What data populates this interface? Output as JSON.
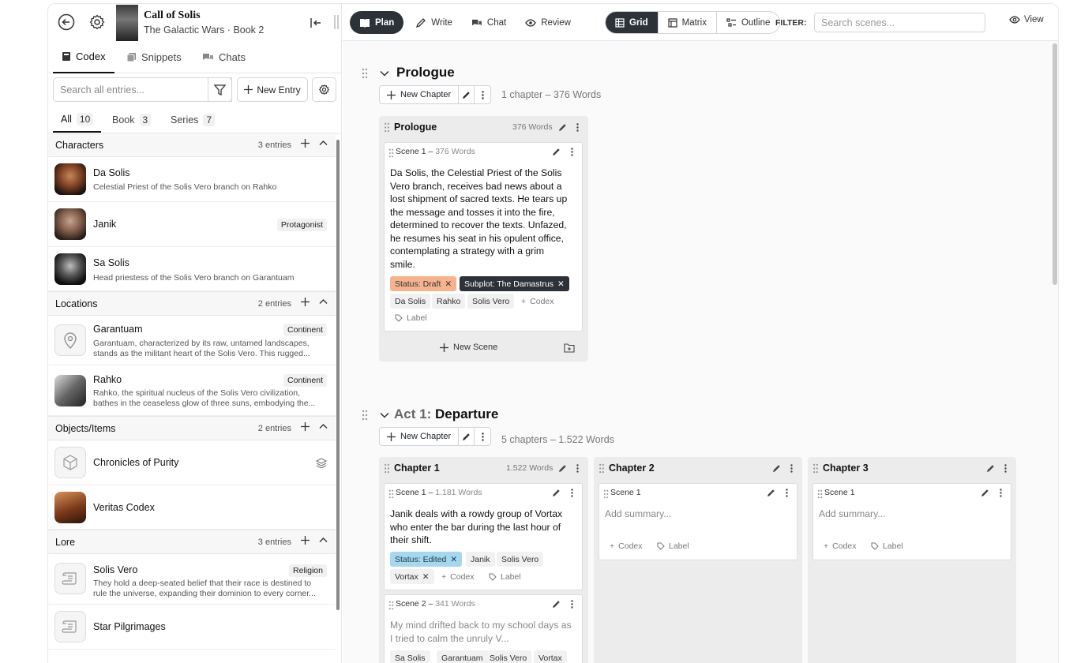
{
  "book": {
    "title": "Call of Solis",
    "subtitle": "The Galactic Wars · Book 2"
  },
  "sidebar": {
    "tabs": [
      {
        "label": "Codex"
      },
      {
        "label": "Snippets"
      },
      {
        "label": "Chats"
      }
    ],
    "search_placeholder": "Search all entries...",
    "new_entry_label": "New Entry",
    "subtabs": [
      {
        "label": "All",
        "count": "10"
      },
      {
        "label": "Book",
        "count": "3"
      },
      {
        "label": "Series",
        "count": "7"
      }
    ],
    "sections": [
      {
        "title": "Characters",
        "count": "3 entries",
        "entries": [
          {
            "name": "Da Solis",
            "desc": "Celestial Priest of the Solis Vero branch on Rahko",
            "tag": ""
          },
          {
            "name": "Janik",
            "desc": "",
            "tag": "Protagonist"
          },
          {
            "name": "Sa Solis",
            "desc": "Head priestess of the Solis Vero branch on Garantuam",
            "tag": ""
          }
        ]
      },
      {
        "title": "Locations",
        "count": "2 entries",
        "entries": [
          {
            "name": "Garantuam",
            "desc": "Garantuam, characterized by its raw, untamed landscapes, stands as the militant heart of the Solis Vero. This rugged...",
            "tag": "Continent"
          },
          {
            "name": "Rahko",
            "desc": "Rahko, the spiritual nucleus of the Solis Vero civilization, bathes in the ceaseless glow of three suns, embodying the...",
            "tag": "Continent"
          }
        ]
      },
      {
        "title": "Objects/Items",
        "count": "2 entries",
        "entries": [
          {
            "name": "Chronicles of Purity",
            "desc": "",
            "tag": ""
          },
          {
            "name": "Veritas Codex",
            "desc": "",
            "tag": ""
          }
        ]
      },
      {
        "title": "Lore",
        "count": "3 entries",
        "entries": [
          {
            "name": "Solis Vero",
            "desc": "They hold a deep-seated belief that their race is destined to rule the universe, expanding their dominion to every corner...",
            "tag": "Religion"
          },
          {
            "name": "Star Pilgrimages",
            "desc": "",
            "tag": ""
          }
        ]
      }
    ]
  },
  "topbar": {
    "modes": [
      {
        "label": "Plan"
      },
      {
        "label": "Write"
      },
      {
        "label": "Chat"
      },
      {
        "label": "Review"
      }
    ],
    "views": [
      {
        "label": "Grid"
      },
      {
        "label": "Matrix"
      },
      {
        "label": "Outline"
      }
    ],
    "filter_label": "FILTER:",
    "filter_placeholder": "Search scenes...",
    "view_label": "View"
  },
  "acts": [
    {
      "prefix": "",
      "title": "Prologue",
      "new_chapter": "New Chapter",
      "meta": "1 chapter  –  376 Words",
      "chapters": [
        {
          "title": "Prologue",
          "words": "376 Words",
          "new_scene": "New Scene",
          "scenes": [
            {
              "header": "Scene 1 –",
              "words": "376 Words",
              "text": "Da Solis, the Celestial Priest of the Solis Vero branch, receives bad news about a lost shipment of sacred texts. He tears up the message and tosses it into the fire, determined to recover the texts. Unfazed, he resumes his seat in his opulent office, contemplating a strategy with a grim smile.",
              "chips": [
                "Status: Draft",
                "Subplot: The Damastrus",
                "Da Solis",
                "Rahko",
                "Solis Vero",
                "Codex",
                "Label"
              ]
            }
          ]
        }
      ]
    },
    {
      "prefix": "Act 1:",
      "title": "Departure",
      "new_chapter": "New Chapter",
      "meta": "5 chapters  –  1.522 Words",
      "chapters": [
        {
          "title": "Chapter 1",
          "words": "1.522 Words",
          "scenes": [
            {
              "header": "Scene 1 –",
              "words": "1.181 Words",
              "text": "Janik deals with a rowdy group of Vortax who enter the bar during the last hour of their shift.",
              "chips": [
                "Status: Edited",
                "Janik",
                "Solis Vero",
                "Vortax",
                "Codex",
                "Label"
              ]
            },
            {
              "header": "Scene 2 –",
              "words": "341 Words",
              "text": "My mind drifted back to my school days as I tried to calm the unruly V...",
              "chips": [
                "Sa Solis",
                "Garantuam",
                "Solis Vero",
                "Vortax"
              ]
            }
          ]
        },
        {
          "title": "Chapter 2",
          "words": "",
          "scenes": [
            {
              "header": "Scene 1",
              "words": "",
              "text": "Add summary...",
              "chips": [
                "Codex",
                "Label"
              ]
            }
          ]
        },
        {
          "title": "Chapter 3",
          "words": "",
          "scenes": [
            {
              "header": "Scene 1",
              "words": "",
              "text": "Add summary...",
              "chips": [
                "Codex",
                "Label"
              ]
            }
          ]
        }
      ]
    }
  ],
  "colors": {
    "accent_dark": "#2d3239",
    "draft": "#f5b48f",
    "edited": "#a7d6ef"
  }
}
